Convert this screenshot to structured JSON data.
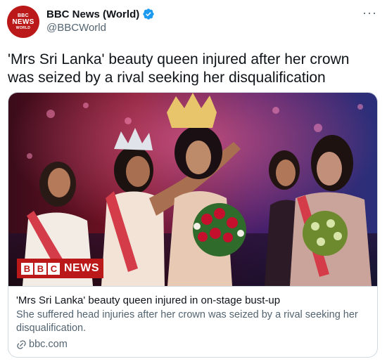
{
  "account": {
    "avatar_lines": [
      "BBC",
      "NEWS",
      "WORLD"
    ],
    "display_name": "BBC News (World)",
    "handle": "@BBCWorld",
    "verified": true
  },
  "more_menu": {
    "icon": "more-horizontal-icon",
    "label": "···"
  },
  "tweet": {
    "text": "'Mrs Sri Lanka' beauty queen injured after her crown was seized by a rival seeking her disqualification"
  },
  "card": {
    "image_badge": {
      "blocks": [
        "B",
        "B",
        "C"
      ],
      "word": "NEWS"
    },
    "title": "'Mrs Sri Lanka' beauty queen injured in on-stage bust-up",
    "description": "She suffered head injuries after her crown was seized by a rival seeking her disqualification.",
    "domain": "bbc.com"
  },
  "colors": {
    "brand_red": "#bb1919",
    "verified_blue": "#1d9bf0",
    "secondary_text": "#536471",
    "border": "#cfd9de"
  }
}
